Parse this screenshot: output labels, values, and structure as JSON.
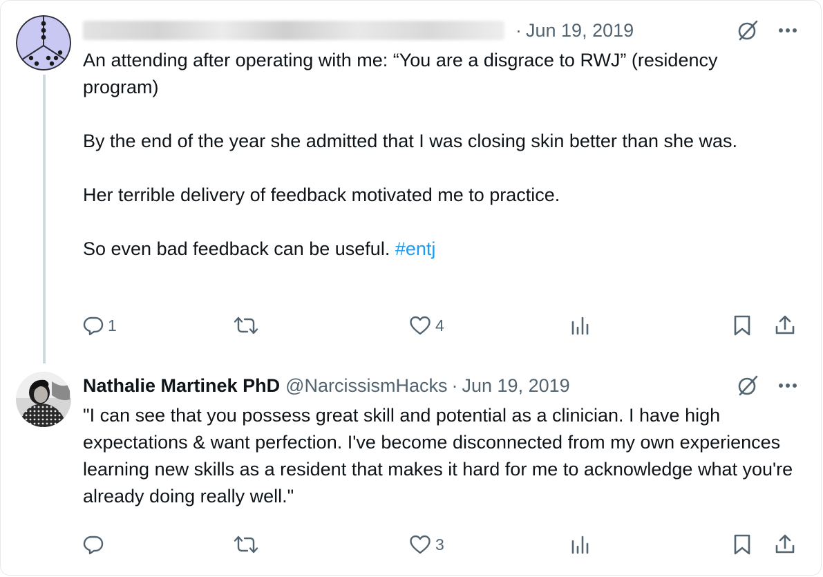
{
  "tweets": [
    {
      "author": {
        "name": "",
        "handle": "",
        "name_blurred": true
      },
      "separator": "·",
      "date": "Jun 19, 2019",
      "paragraphs": [
        "An attending after operating with me: “You are a disgrace to RWJ” (residency program)",
        "By the end of the year she admitted that I was closing skin better than she was.",
        "Her terrible delivery of feedback motivated me to practice."
      ],
      "last_paragraph": "So even bad feedback can be useful.",
      "hashtag": "#entj",
      "actions": {
        "replies": "1",
        "reposts": "",
        "likes": "4",
        "views": ""
      }
    },
    {
      "author": {
        "name": "Nathalie Martinek PhD",
        "handle": "@NarcissismHacks"
      },
      "separator": "·",
      "date": "Jun 19, 2019",
      "text": "\"I can see that you possess great skill and potential as a clinician. I have high expectations & want perfection. I've become disconnected from my own experiences learning new skills as a resident that makes it hard for me to acknowledge what you're already doing really well.\"",
      "actions": {
        "replies": "",
        "reposts": "",
        "likes": "3",
        "views": ""
      }
    }
  ],
  "icons": {
    "reply": "reply-icon",
    "repost": "repost-icon",
    "like": "heart-icon",
    "views": "analytics-icon",
    "bookmark": "bookmark-icon",
    "share": "share-icon",
    "grok": "grok-icon",
    "more": "more-icon"
  },
  "colors": {
    "text": "#0f1419",
    "secondary": "#536471",
    "link": "#1d9bf0",
    "thread_line": "#cfd9de",
    "avatar_bg": "#c9c8f2"
  }
}
